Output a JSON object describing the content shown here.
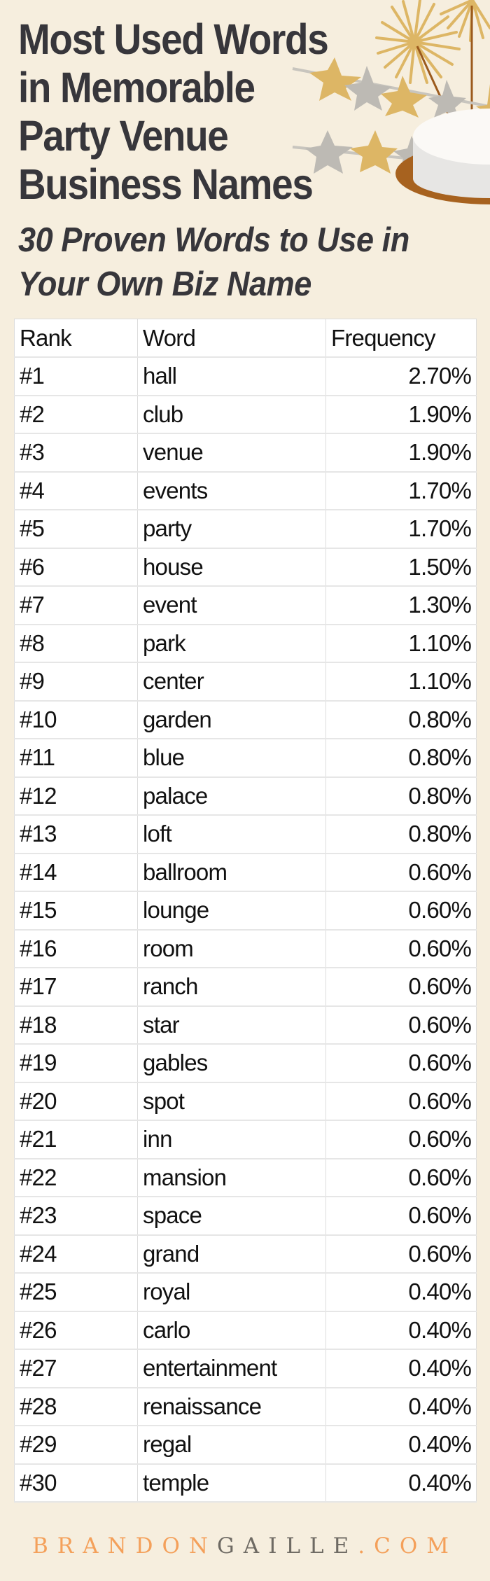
{
  "header": {
    "title_lines": [
      "Most Used Words",
      "in Memorable",
      "Party Venue",
      "Business Names"
    ],
    "subtitle_lines": [
      "30 Proven Words to Use in",
      "Your Own Biz Name"
    ],
    "decoration_icon": "birthday-cake-with-sparklers-and-stars-icon"
  },
  "table": {
    "columns": [
      "Rank",
      "Word",
      "Frequency"
    ],
    "rows": [
      {
        "rank": "#1",
        "word": "hall",
        "frequency": "2.70%"
      },
      {
        "rank": "#2",
        "word": "club",
        "frequency": "1.90%"
      },
      {
        "rank": "#3",
        "word": "venue",
        "frequency": "1.90%"
      },
      {
        "rank": "#4",
        "word": "events",
        "frequency": "1.70%"
      },
      {
        "rank": "#5",
        "word": "party",
        "frequency": "1.70%"
      },
      {
        "rank": "#6",
        "word": "house",
        "frequency": "1.50%"
      },
      {
        "rank": "#7",
        "word": "event",
        "frequency": "1.30%"
      },
      {
        "rank": "#8",
        "word": "park",
        "frequency": "1.10%"
      },
      {
        "rank": "#9",
        "word": "center",
        "frequency": "1.10%"
      },
      {
        "rank": "#10",
        "word": "garden",
        "frequency": "0.80%"
      },
      {
        "rank": "#11",
        "word": "blue",
        "frequency": "0.80%"
      },
      {
        "rank": "#12",
        "word": "palace",
        "frequency": "0.80%"
      },
      {
        "rank": "#13",
        "word": "loft",
        "frequency": "0.80%"
      },
      {
        "rank": "#14",
        "word": "ballroom",
        "frequency": "0.60%"
      },
      {
        "rank": "#15",
        "word": "lounge",
        "frequency": "0.60%"
      },
      {
        "rank": "#16",
        "word": "room",
        "frequency": "0.60%"
      },
      {
        "rank": "#17",
        "word": "ranch",
        "frequency": "0.60%"
      },
      {
        "rank": "#18",
        "word": "star",
        "frequency": "0.60%"
      },
      {
        "rank": "#19",
        "word": "gables",
        "frequency": "0.60%"
      },
      {
        "rank": "#20",
        "word": "spot",
        "frequency": "0.60%"
      },
      {
        "rank": "#21",
        "word": "inn",
        "frequency": "0.60%"
      },
      {
        "rank": "#22",
        "word": "mansion",
        "frequency": "0.60%"
      },
      {
        "rank": "#23",
        "word": "space",
        "frequency": "0.60%"
      },
      {
        "rank": "#24",
        "word": "grand",
        "frequency": "0.60%"
      },
      {
        "rank": "#25",
        "word": "royal",
        "frequency": "0.40%"
      },
      {
        "rank": "#26",
        "word": "carlo",
        "frequency": "0.40%"
      },
      {
        "rank": "#27",
        "word": "entertainment",
        "frequency": "0.40%"
      },
      {
        "rank": "#28",
        "word": "renaissance",
        "frequency": "0.40%"
      },
      {
        "rank": "#29",
        "word": "regal",
        "frequency": "0.40%"
      },
      {
        "rank": "#30",
        "word": "temple",
        "frequency": "0.40%"
      }
    ]
  },
  "footer": {
    "brand_part1": "BRANDON",
    "brand_part2": "GAILLE",
    "brand_part3": ".COM"
  },
  "colors": {
    "background": "#F6EEDE",
    "title_text": "#37363B",
    "brand_orange": "#F4A05A",
    "brand_gray": "#6E6A63",
    "gold": "#DDB665",
    "silver": "#BDBAB4",
    "cake_plate": "#A7621F"
  }
}
